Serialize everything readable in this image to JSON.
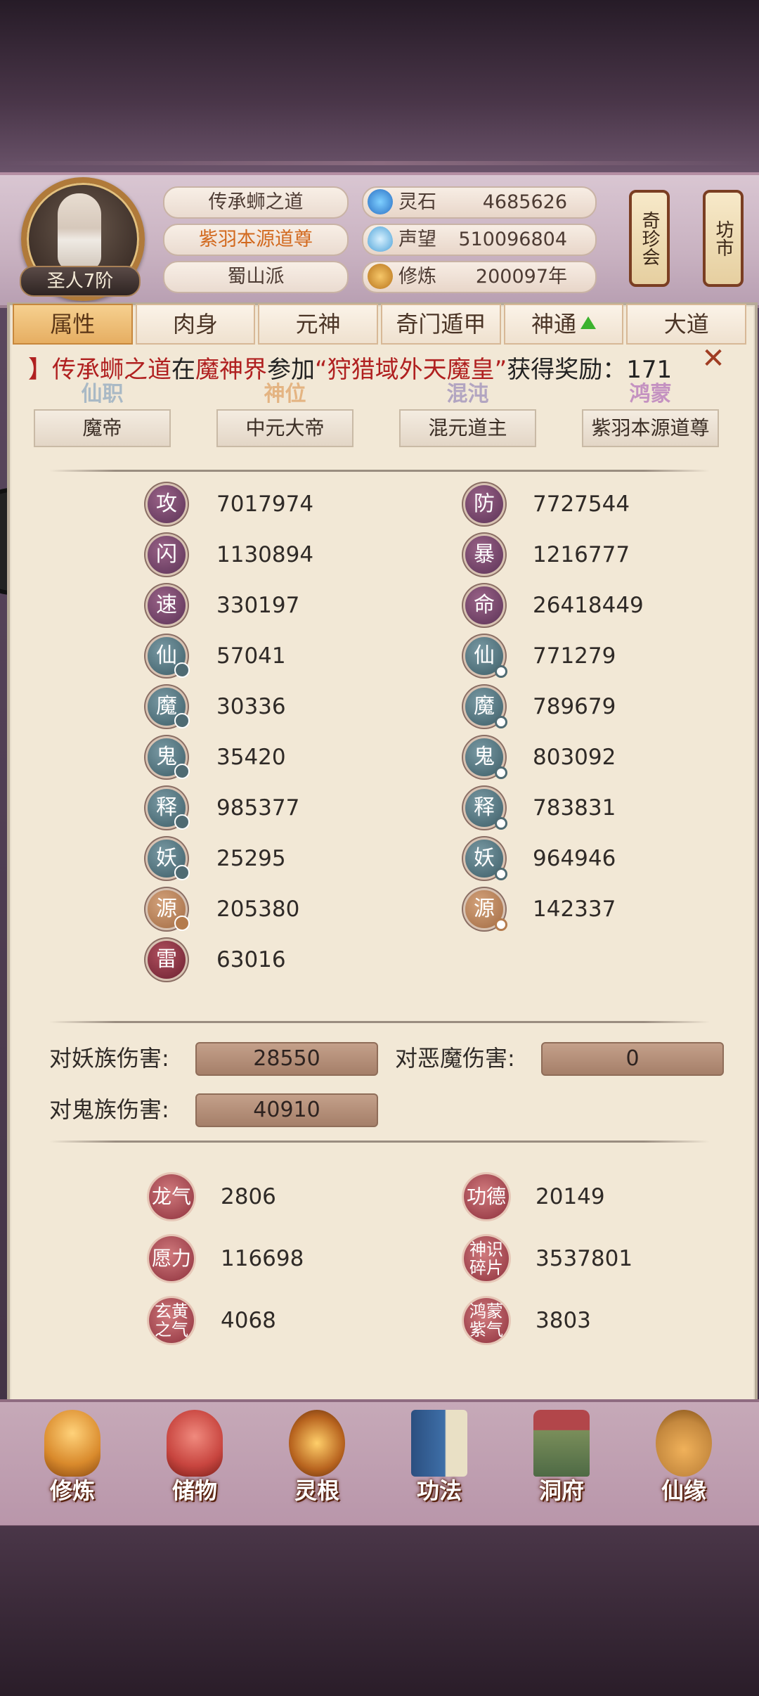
{
  "header": {
    "rank_badge": "圣人7阶",
    "name": "传承蛳之道",
    "title": "紫羽本源道尊",
    "sect": "蜀山派",
    "stats": [
      {
        "label": "灵石",
        "value": "4685626",
        "icon": "spirit-stone-icon"
      },
      {
        "label": "声望",
        "value": "510096804",
        "icon": "reputation-icon"
      },
      {
        "label": "修炼",
        "value": "200097年",
        "icon": "cultivation-icon"
      }
    ],
    "scroll_buttons": [
      "奇珍会",
      "坊市"
    ]
  },
  "tabs": [
    {
      "label": "属性"
    },
    {
      "label": "肉身"
    },
    {
      "label": "元神"
    },
    {
      "label": "奇门遁甲"
    },
    {
      "label": "神通"
    },
    {
      "label": "大道"
    }
  ],
  "marquee": {
    "bracket": "】",
    "player": "传承蛳之道",
    "in": "在",
    "realm": "魔神界",
    "join": "参加",
    "event": "“狩猎域外天魔皇”",
    "reward": "获得奖励：171"
  },
  "ranks": [
    {
      "title": "仙职",
      "value": "魔帝",
      "color": "#6f94b8"
    },
    {
      "title": "神位",
      "value": "中元大帝",
      "color": "#d98a3e"
    },
    {
      "title": "混沌",
      "value": "混元道主",
      "color": "#7f6fb0"
    },
    {
      "title": "鸿蒙",
      "value": "紫羽本源道尊",
      "color": "#a04db0"
    }
  ],
  "attributes_left": [
    {
      "glyph": "攻",
      "value": "7017974",
      "style": "purple"
    },
    {
      "glyph": "闪",
      "value": "1130894",
      "style": "purple"
    },
    {
      "glyph": "速",
      "value": "330197",
      "style": "purple"
    },
    {
      "glyph": "仙",
      "value": "57041",
      "style": "teal"
    },
    {
      "glyph": "魔",
      "value": "30336",
      "style": "teal"
    },
    {
      "glyph": "鬼",
      "value": "35420",
      "style": "teal"
    },
    {
      "glyph": "释",
      "value": "985377",
      "style": "teal"
    },
    {
      "glyph": "妖",
      "value": "25295",
      "style": "teal"
    },
    {
      "glyph": "源",
      "value": "205380",
      "style": "amber"
    },
    {
      "glyph": "雷",
      "value": "63016",
      "style": "red"
    }
  ],
  "attributes_right": [
    {
      "glyph": "防",
      "value": "7727544",
      "style": "purple"
    },
    {
      "glyph": "暴",
      "value": "1216777",
      "style": "purple"
    },
    {
      "glyph": "命",
      "value": "26418449",
      "style": "purple"
    },
    {
      "glyph": "仙",
      "value": "771279",
      "style": "teal"
    },
    {
      "glyph": "魔",
      "value": "789679",
      "style": "teal"
    },
    {
      "glyph": "鬼",
      "value": "803092",
      "style": "teal"
    },
    {
      "glyph": "释",
      "value": "783831",
      "style": "teal"
    },
    {
      "glyph": "妖",
      "value": "964946",
      "style": "teal"
    },
    {
      "glyph": "源",
      "value": "142337",
      "style": "amber"
    }
  ],
  "damage": [
    {
      "label": "对妖族伤害:",
      "value": "28550"
    },
    {
      "label": "对恶魔伤害:",
      "value": "0"
    },
    {
      "label": "对鬼族伤害:",
      "value": "40910"
    }
  ],
  "resources_left": [
    {
      "glyph": "龙气",
      "value": "2806"
    },
    {
      "glyph": "愿力",
      "value": "116698"
    },
    {
      "glyph": "玄黄之气",
      "value": "4068"
    }
  ],
  "resources_right": [
    {
      "glyph": "功德",
      "value": "20149"
    },
    {
      "glyph": "神识碎片",
      "value": "3537801"
    },
    {
      "glyph": "鸿蒙紫气",
      "value": "3803"
    }
  ],
  "nav": [
    {
      "label": "修炼",
      "icon": "monk-icon",
      "color": "#d98a2c"
    },
    {
      "label": "储物",
      "icon": "bag-icon",
      "color": "#c8453f"
    },
    {
      "label": "灵根",
      "icon": "spirit-root-icon",
      "color": "#b8641f"
    },
    {
      "label": "功法",
      "icon": "book-icon",
      "color": "#3e6fa8"
    },
    {
      "label": "洞府",
      "icon": "palace-icon",
      "color": "#7a8e5a"
    },
    {
      "label": "仙缘",
      "icon": "gourd-icon",
      "color": "#c4883e"
    }
  ]
}
